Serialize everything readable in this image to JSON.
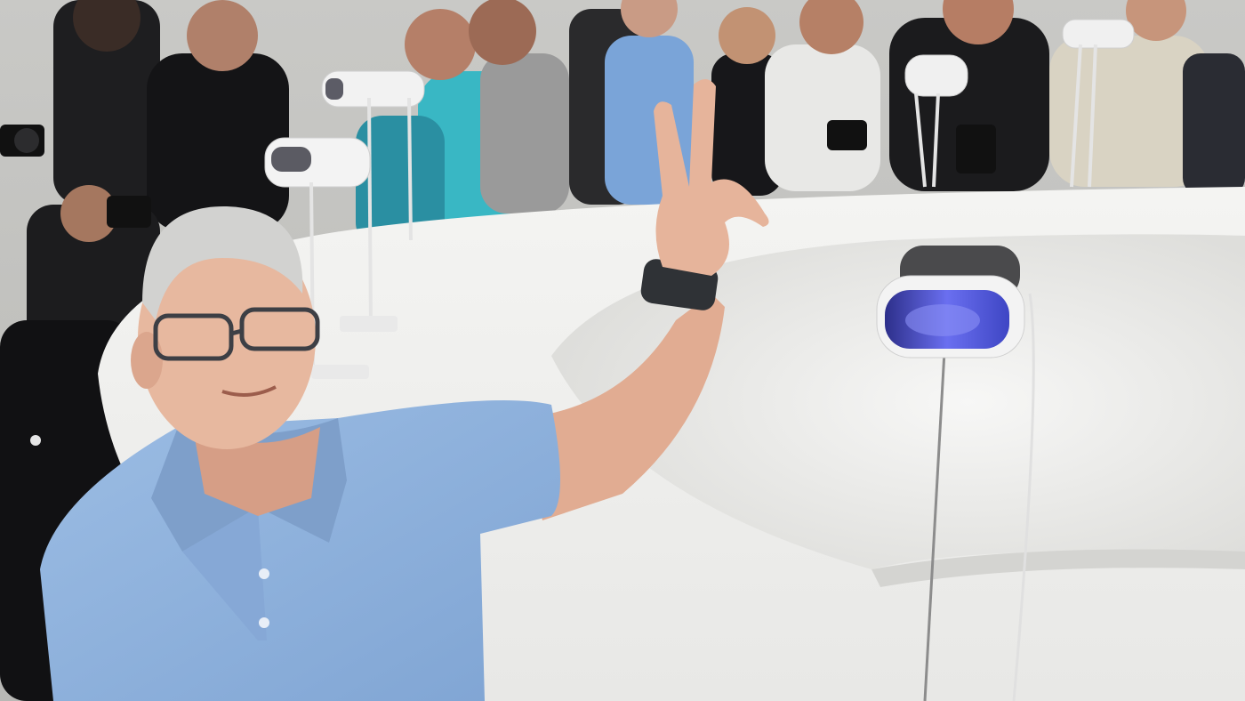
{
  "photo": {
    "subject": "man-in-blue-polo-making-peace-sign",
    "colors": {
      "background_wall": "#cfcfcc",
      "table_white": "#f1f1ef",
      "table_shadow": "#dcdcda",
      "polo_blue": "#8fb3dd",
      "polo_blue_dark": "#6f94c4",
      "skin": "#e7b89f",
      "skin_shadow": "#c98f76",
      "hair_gray": "#d2d2d0",
      "headset_gray": "#4a4a4c",
      "headset_visor": "#4b57d8",
      "crowd_black": "#1c1c1e",
      "crowd_teal": "#39b7c4",
      "watch_band": "#2f3236"
    }
  }
}
